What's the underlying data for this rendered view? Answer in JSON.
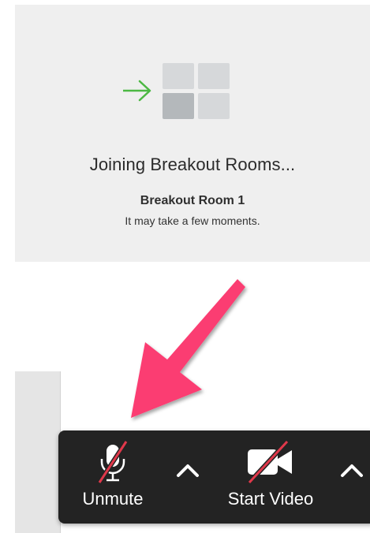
{
  "dialog": {
    "title": "Joining Breakout Rooms...",
    "room_name": "Breakout Room 1",
    "note": "It may take a few moments.",
    "illustration_icon": "breakout-rooms-join-icon",
    "accent_color": "#4cb843"
  },
  "toolbar": {
    "unmute_label": "Unmute",
    "unmute_icon": "microphone-muted-icon",
    "audio_options_icon": "chevron-up-icon",
    "start_video_label": "Start Video",
    "start_video_icon": "video-camera-off-icon",
    "video_options_icon": "chevron-up-icon",
    "off_slash_color": "#e0384a",
    "background_color": "#232323"
  },
  "annotation": {
    "arrow_icon": "pink-pointer-arrow",
    "arrow_color": "#fb3d72"
  }
}
